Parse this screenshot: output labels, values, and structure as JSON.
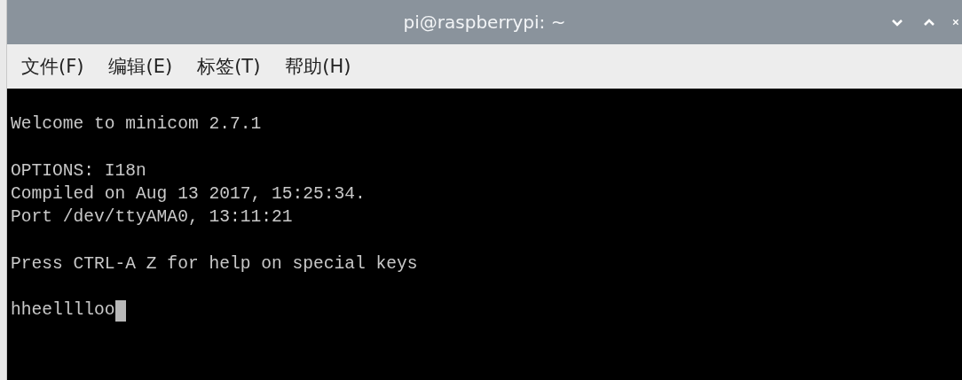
{
  "window": {
    "title": "pi@raspberrypi: ~"
  },
  "menu": [
    {
      "label": "文件(F)"
    },
    {
      "label": "编辑(E)"
    },
    {
      "label": "标签(T)"
    },
    {
      "label": "帮助(H)"
    }
  ],
  "terminal": {
    "lines": [
      {
        "kind": "text",
        "text": "Welcome to minicom 2.7.1"
      },
      {
        "kind": "blank"
      },
      {
        "kind": "text",
        "text": "OPTIONS: I18n"
      },
      {
        "kind": "text",
        "text": "Compiled on Aug 13 2017, 15:25:34."
      },
      {
        "kind": "text",
        "text": "Port /dev/ttyAMA0, 13:11:21"
      },
      {
        "kind": "blank"
      },
      {
        "kind": "text",
        "text": "Press CTRL-A Z for help on special keys"
      },
      {
        "kind": "blank"
      },
      {
        "kind": "input",
        "text": "hheelllloo"
      }
    ]
  }
}
